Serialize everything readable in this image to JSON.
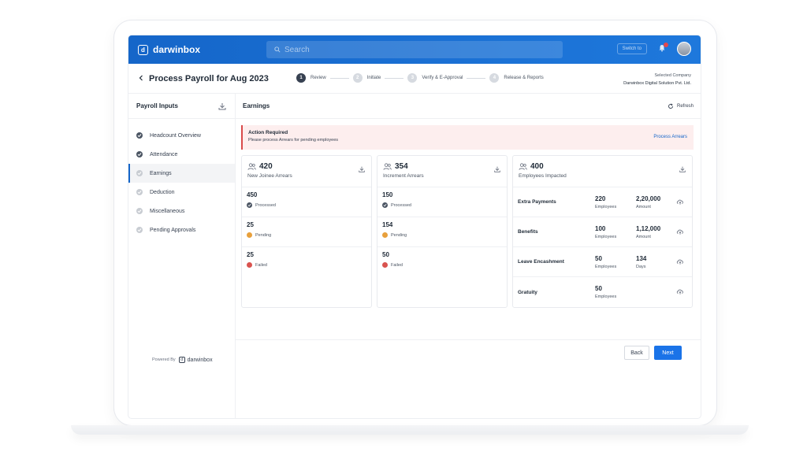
{
  "app": {
    "brand": "darwinbox",
    "brand_mark": "d"
  },
  "topbar": {
    "search_placeholder": "Search",
    "pill_label": "Switch to",
    "notification_count": "1"
  },
  "header": {
    "back_icon": "chevron-left-icon",
    "title": "Process Payroll for Aug 2023",
    "steps": [
      {
        "num": "1",
        "label": "Review",
        "active": true
      },
      {
        "num": "2",
        "label": "Initiate",
        "active": false
      },
      {
        "num": "3",
        "label": "Verify & E-Approval",
        "active": false
      },
      {
        "num": "4",
        "label": "Release & Reports",
        "active": false
      }
    ],
    "company_label": "Selected Company",
    "company_name": "Darwinbox Digital Solution Pvt. Ltd."
  },
  "sidebar": {
    "title": "Payroll Inputs",
    "items": [
      {
        "label": "Headcount Overview",
        "done": true
      },
      {
        "label": "Attendance",
        "done": true
      },
      {
        "label": "Earnings",
        "done": false,
        "active": true
      },
      {
        "label": "Deduction",
        "done": false
      },
      {
        "label": "Miscellaneous",
        "done": false
      },
      {
        "label": "Pending Approvals",
        "done": false
      }
    ],
    "powered_by": "Powered By",
    "powered_brand": "darwinbox"
  },
  "main": {
    "title": "Earnings",
    "refresh_label": "Refresh",
    "alert": {
      "title": "Action Required",
      "text": "Please process Arrears for pending employees",
      "link": "Process Arrears"
    },
    "cards": [
      {
        "count": "420",
        "label": "New Joinee Arrears",
        "metrics": [
          {
            "value": "450",
            "status": "Processed",
            "color": "#4b5563"
          },
          {
            "value": "25",
            "status": "Pending",
            "color": "#e8a03c"
          },
          {
            "value": "25",
            "status": "Failed",
            "color": "#d9534f"
          }
        ]
      },
      {
        "count": "354",
        "label": "Increment Arrears",
        "metrics": [
          {
            "value": "150",
            "status": "Processed",
            "color": "#4b5563"
          },
          {
            "value": "154",
            "status": "Pending",
            "color": "#e8a03c"
          },
          {
            "value": "50",
            "status": "Failed",
            "color": "#d9534f"
          }
        ]
      }
    ],
    "impact": {
      "count": "400",
      "label": "Employees Impacted",
      "rows": [
        {
          "label": "Extra Payments",
          "emp": "220",
          "emp_unit": "Employees",
          "amt": "2,20,000",
          "amt_unit": "Amount"
        },
        {
          "label": "Benefits",
          "emp": "100",
          "emp_unit": "Employees",
          "amt": "1,12,000",
          "amt_unit": "Amount"
        },
        {
          "label": "Leave Encashment",
          "emp": "50",
          "emp_unit": "Employees",
          "amt": "134",
          "amt_unit": "Days"
        },
        {
          "label": "Gratuity",
          "emp": "50",
          "emp_unit": "Employees",
          "amt": "",
          "amt_unit": ""
        }
      ]
    },
    "back_label": "Back",
    "next_label": "Next"
  }
}
